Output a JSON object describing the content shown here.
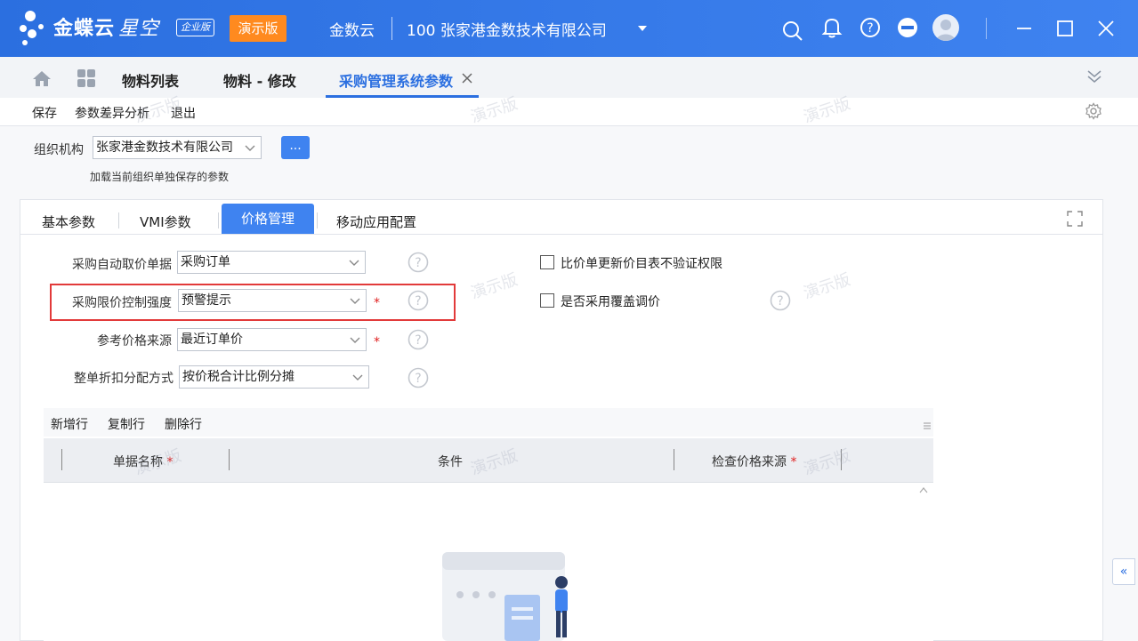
{
  "app": {
    "brand": "金蝶云",
    "brand_star": "星空",
    "edition_badge": "企业版",
    "demo_button": "演示版",
    "product": "金数云",
    "company": "100  张家港金数技术有限公司"
  },
  "tabs": {
    "list": "物料列表",
    "edit": "物料 - 修改",
    "active": "采购管理系统参数"
  },
  "toolbar": {
    "save": "保存",
    "diff": "参数差异分析",
    "exit": "退出"
  },
  "org": {
    "label": "组织机构",
    "value": "张家港金数技术有限公司",
    "button": "...",
    "hint": "加载当前组织单独保存的参数"
  },
  "panel_tabs": [
    "基本参数",
    "VMI参数",
    "价格管理",
    "移动应用配置"
  ],
  "fields": {
    "auto_price_label": "采购自动取价单据",
    "auto_price_value": "采购订单",
    "limit_label": "采购限价控制强度",
    "limit_value": "预警提示",
    "source_label": "参考价格来源",
    "source_value": "最近订单价",
    "discount_label": "整单折扣分配方式",
    "discount_value": "按价税合计比例分摊",
    "required_mark": "*"
  },
  "checks": {
    "compare_label": "比价单更新价目表不验证权限",
    "cover_label": "是否采用覆盖调价"
  },
  "grid": {
    "add": "新增行",
    "copy": "复制行",
    "delete": "删除行",
    "col_name": "单据名称",
    "col_cond": "条件",
    "col_source": "检查价格来源",
    "req": "*"
  },
  "watermark": "演示版",
  "side_button": "«",
  "colors": {
    "primary": "#2b6fe0",
    "demo": "#ff8a1f",
    "required": "#e02020",
    "highlight": "#e23a3a"
  }
}
